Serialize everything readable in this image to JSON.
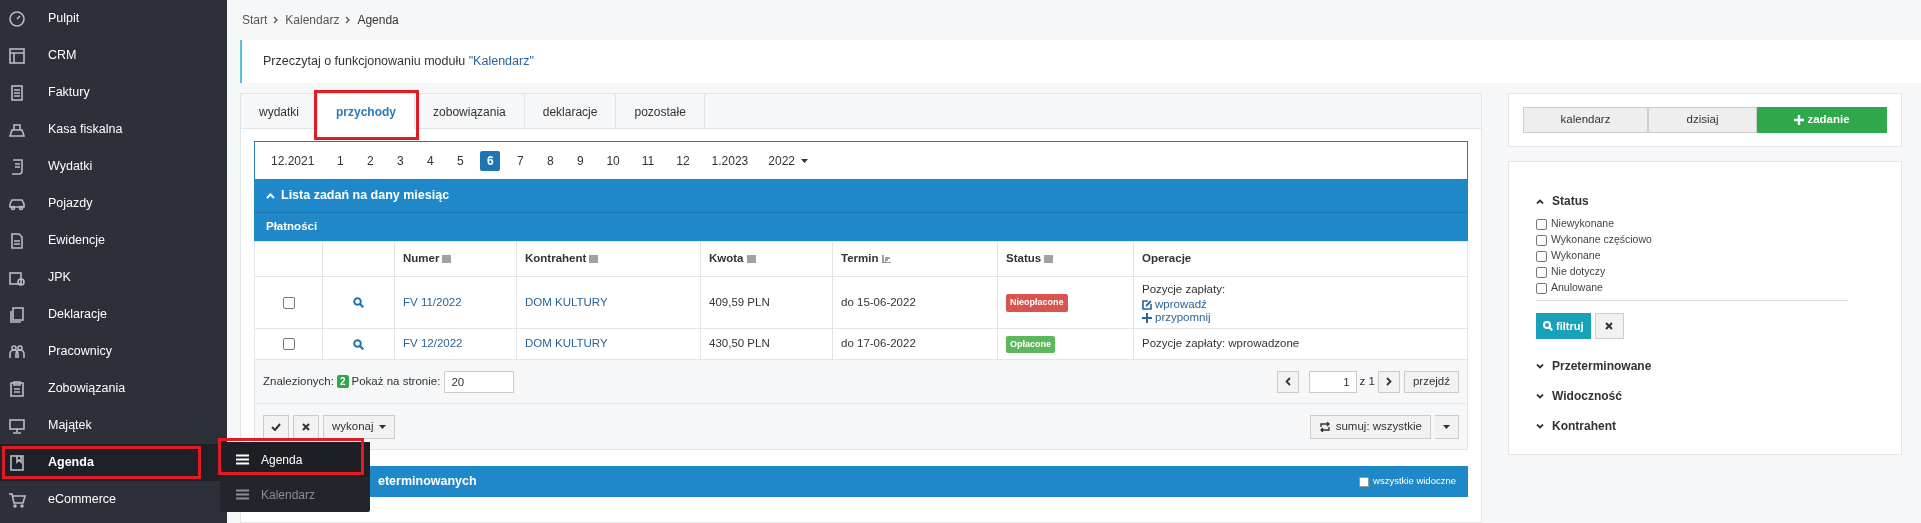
{
  "sidebar": {
    "items": [
      {
        "label": "Pulpit",
        "selected": false,
        "highlighted": false
      },
      {
        "label": "CRM",
        "selected": false,
        "highlighted": false
      },
      {
        "label": "Faktury",
        "selected": false,
        "highlighted": false
      },
      {
        "label": "Kasa fiskalna",
        "selected": false,
        "highlighted": false
      },
      {
        "label": "Wydatki",
        "selected": false,
        "highlighted": false
      },
      {
        "label": "Pojazdy",
        "selected": false,
        "highlighted": false
      },
      {
        "label": "Ewidencje",
        "selected": false,
        "highlighted": false
      },
      {
        "label": "JPK",
        "selected": false,
        "highlighted": false
      },
      {
        "label": "Deklaracje",
        "selected": false,
        "highlighted": false
      },
      {
        "label": "Pracownicy",
        "selected": false,
        "highlighted": false
      },
      {
        "label": "Zobowiązania",
        "selected": false,
        "highlighted": false
      },
      {
        "label": "Majątek",
        "selected": false,
        "highlighted": false
      },
      {
        "label": "Agenda",
        "selected": true,
        "highlighted": true
      },
      {
        "label": "eCommerce",
        "selected": false,
        "highlighted": false
      }
    ]
  },
  "submenu": {
    "items": [
      {
        "label": "Agenda",
        "selected": true,
        "highlighted": true
      },
      {
        "label": "Kalendarz",
        "selected": false,
        "highlighted": false
      }
    ]
  },
  "breadcrumb": [
    "Start",
    "Kalendarz",
    "Agenda"
  ],
  "info": {
    "text": "Przeczytaj o funkcjonowaniu modułu ",
    "link": "\"Kalendarz\""
  },
  "tabs": [
    {
      "label": "wydatki",
      "selected": false,
      "highlighted": false
    },
    {
      "label": "przychody",
      "selected": true,
      "highlighted": true
    },
    {
      "label": "zobowiązania",
      "selected": false,
      "highlighted": false
    },
    {
      "label": "deklaracje",
      "selected": false,
      "highlighted": false
    },
    {
      "label": "pozostałe",
      "selected": false,
      "highlighted": false
    }
  ],
  "months": [
    {
      "label": "12.2021",
      "selected": false
    },
    {
      "label": "1",
      "selected": false
    },
    {
      "label": "2",
      "selected": false
    },
    {
      "label": "3",
      "selected": false
    },
    {
      "label": "4",
      "selected": false
    },
    {
      "label": "5",
      "selected": false
    },
    {
      "label": "6",
      "selected": true
    },
    {
      "label": "7",
      "selected": false
    },
    {
      "label": "8",
      "selected": false
    },
    {
      "label": "9",
      "selected": false
    },
    {
      "label": "10",
      "selected": false
    },
    {
      "label": "11",
      "selected": false
    },
    {
      "label": "12",
      "selected": false
    },
    {
      "label": "1.2023",
      "selected": false
    }
  ],
  "year": "2022",
  "section": {
    "title": "Lista zadań na dany miesiąc",
    "expanded": true,
    "subtitle": "Płatności"
  },
  "table": {
    "columns": [
      {},
      {},
      {
        "label": "Numer",
        "sortable": true,
        "sorted": false
      },
      {
        "label": "Kontrahent",
        "sortable": true,
        "sorted": false
      },
      {
        "label": "Kwota",
        "sortable": true,
        "sorted": false
      },
      {
        "label": "Termin",
        "sortable": true,
        "sorted": true
      },
      {
        "label": "Status",
        "sortable": true,
        "sorted": false
      },
      {
        "label": "Operacje",
        "sortable": false
      }
    ],
    "rows": [
      {
        "checked": false,
        "number": "FV 11/2022",
        "contractor": "DOM KULTURY",
        "amount": "409,59 PLN",
        "due": "do 15-06-2022",
        "status": {
          "label": "Nieopłacone",
          "kind": "unpaid"
        },
        "operations": {
          "text": "Pozycje zapłaty:",
          "links": [
            {
              "label": "wprowadź",
              "kind": "edit"
            },
            {
              "label": "przypomnij",
              "kind": "add"
            }
          ]
        }
      },
      {
        "checked": false,
        "number": "FV 12/2022",
        "contractor": "DOM KULTURY",
        "amount": "430,50 PLN",
        "due": "do 17-06-2022",
        "status": {
          "label": "Opłacone",
          "kind": "paid"
        },
        "operations": {
          "text": "Pozycje zapłaty: wprowadzone"
        }
      }
    ]
  },
  "footer": {
    "found_label": "Znalezionych:",
    "found_count": "2",
    "per_page_label": "Pokaż na stronie:",
    "per_page": "20",
    "page": "1",
    "page_total": "z 1",
    "go": "przejdź"
  },
  "actions": {
    "run": "wykonaj",
    "sum": "sumuj: wszystkie"
  },
  "second_section": {
    "title": "eterminowanych",
    "checkbox": {
      "label": "wszystkie widoczne",
      "checked": false
    }
  },
  "right": {
    "buttons": [
      {
        "label": "kalendarz",
        "kind": "plain"
      },
      {
        "label": "dzisiaj",
        "kind": "plain"
      },
      {
        "label": "zadanie",
        "kind": "add"
      }
    ],
    "filters": [
      {
        "title": "Status",
        "expanded": true,
        "options": [
          {
            "label": "Niewykonane",
            "checked": false
          },
          {
            "label": "Wykonane częściowo",
            "checked": false
          },
          {
            "label": "Wykonane",
            "checked": false
          },
          {
            "label": "Nie dotyczy",
            "checked": false
          },
          {
            "label": "Anulowane",
            "checked": false
          }
        ]
      },
      {
        "title": "Przeterminowane",
        "expanded": false
      },
      {
        "title": "Widoczność",
        "expanded": false
      },
      {
        "title": "Kontrahent",
        "expanded": false
      }
    ],
    "filter_button": "filtruj"
  }
}
